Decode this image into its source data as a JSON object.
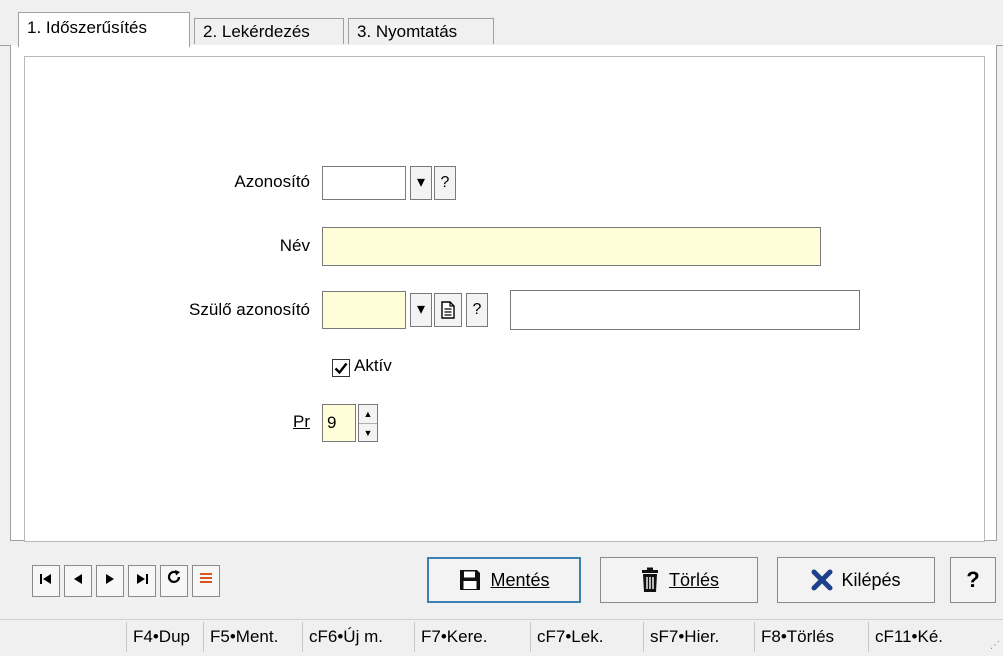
{
  "tabs": [
    {
      "label": "1. Időszerűsítés",
      "active": true
    },
    {
      "label": "2. Lekérdezés",
      "active": false
    },
    {
      "label": "3. Nyomtatás",
      "active": false
    }
  ],
  "form": {
    "azonosito_label": "Azonosító",
    "azonosito_value": "",
    "nev_label": "Név",
    "nev_value": "",
    "szulo_label": "Szülő azonosító",
    "szulo_value": "",
    "szulo_name_value": "",
    "aktiv_label": "Aktív",
    "aktiv_checked": true,
    "pr_label": "Pr",
    "pr_value": "9",
    "question_glyph": "?",
    "dropdown_glyph": "▾"
  },
  "buttons": {
    "save_label": "Mentés",
    "delete_label": "Törlés",
    "exit_label": "Kilépés",
    "help_label": "?"
  },
  "function_keys": [
    "F4•Dup",
    "F5•Ment.",
    "cF6•Új m.",
    "F7•Kere.",
    "cF7•Lek.",
    "sF7•Hier.",
    "F8•Törlés",
    "cF11•Ké."
  ],
  "colors": {
    "required_field": "#fffed8",
    "exit_icon": "#1e3f8a",
    "list_icon": "#d9541e"
  },
  "icons": {
    "nav": [
      "first-record-icon",
      "previous-record-icon",
      "next-record-icon",
      "last-record-icon",
      "refresh-icon",
      "list-icon"
    ],
    "save": "floppy-disk-icon",
    "delete": "trash-icon",
    "exit": "x-mark-icon",
    "lookup": "document-icon"
  }
}
